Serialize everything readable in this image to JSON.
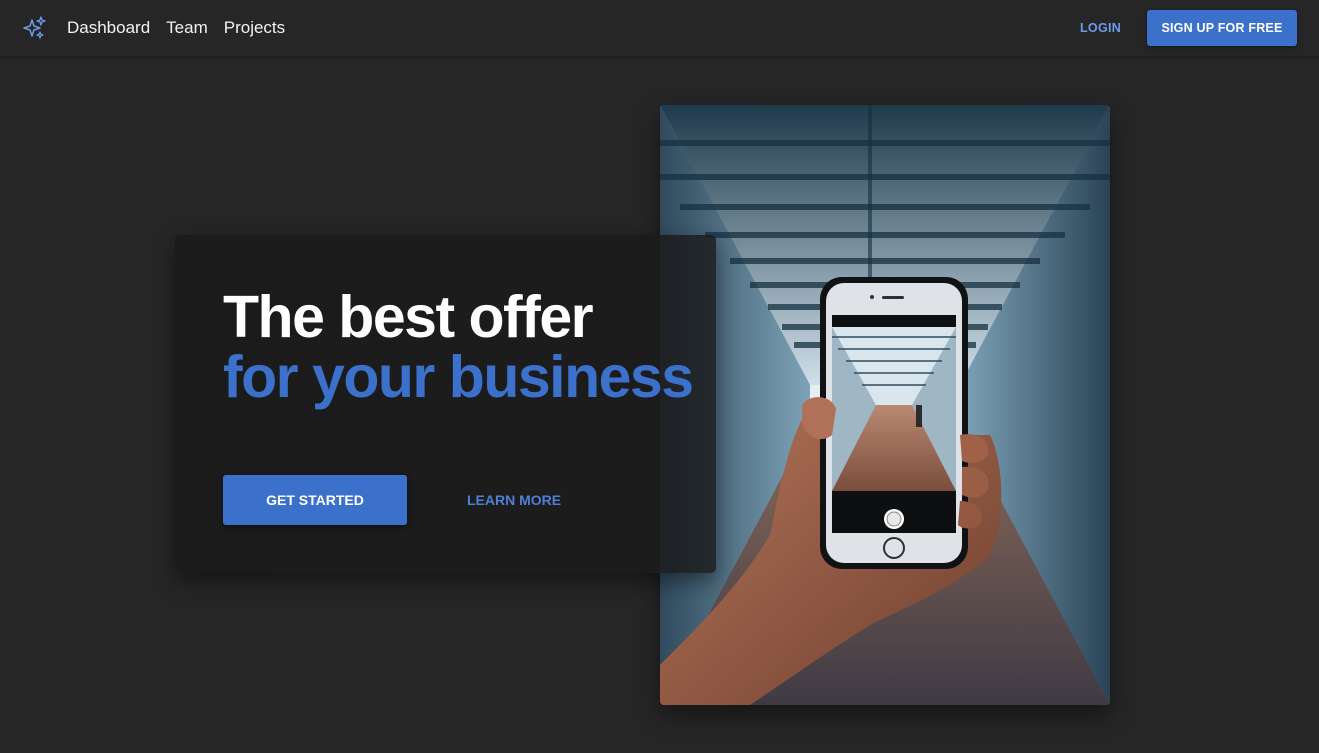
{
  "nav": {
    "logo_icon": "sparkles-icon",
    "links": [
      {
        "label": "Dashboard"
      },
      {
        "label": "Team"
      },
      {
        "label": "Projects"
      }
    ],
    "login_label": "LOGIN",
    "signup_label": "SIGN UP FOR FREE"
  },
  "hero": {
    "headline_line1": "The best offer",
    "headline_line2": "for your business",
    "primary_cta": "GET STARTED",
    "secondary_cta": "LEARN MORE",
    "image_icon": "hand-holding-phone-photo"
  },
  "colors": {
    "background": "#262626",
    "card": "#1b1b1c",
    "accent": "#3b71ca",
    "text": "#ffffff"
  }
}
